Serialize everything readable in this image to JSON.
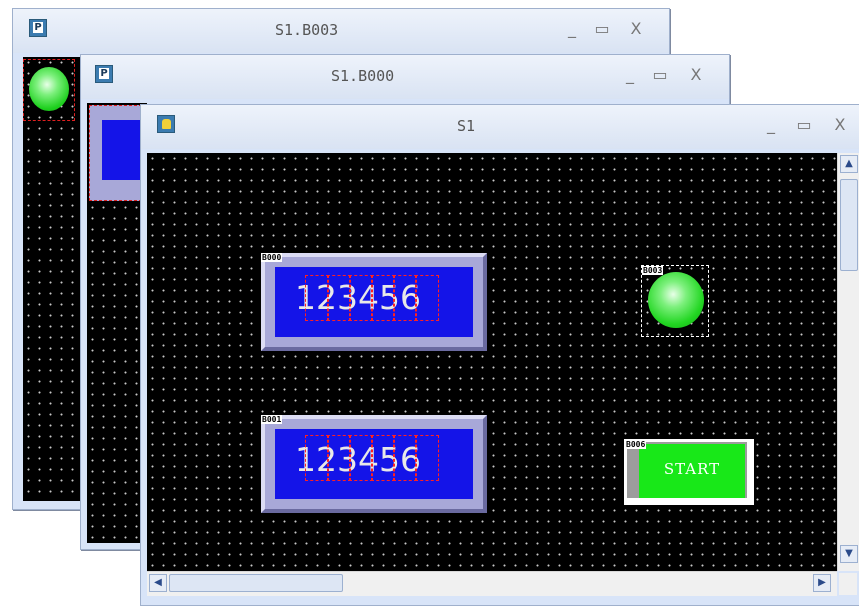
{
  "windows": [
    {
      "title": "S1.B003"
    },
    {
      "title": "S1.B000"
    },
    {
      "title": "S1"
    }
  ],
  "controls": {
    "minimize": "_",
    "maximize": "▭",
    "close": "X"
  },
  "icons": {
    "back_window_icon": "P",
    "main_window_icon": "hand-pointer"
  },
  "objects": {
    "b000": {
      "tag": "B000",
      "value": "123456"
    },
    "b001": {
      "tag": "B001",
      "value": "123456"
    },
    "b003": {
      "tag": "B003"
    },
    "b006": {
      "tag": "B006",
      "label": "START"
    }
  },
  "colors": {
    "canvas": "#000000",
    "display_blue": "#1414e8",
    "lamp_green": "#2ee82e",
    "button_green": "#18e818"
  }
}
